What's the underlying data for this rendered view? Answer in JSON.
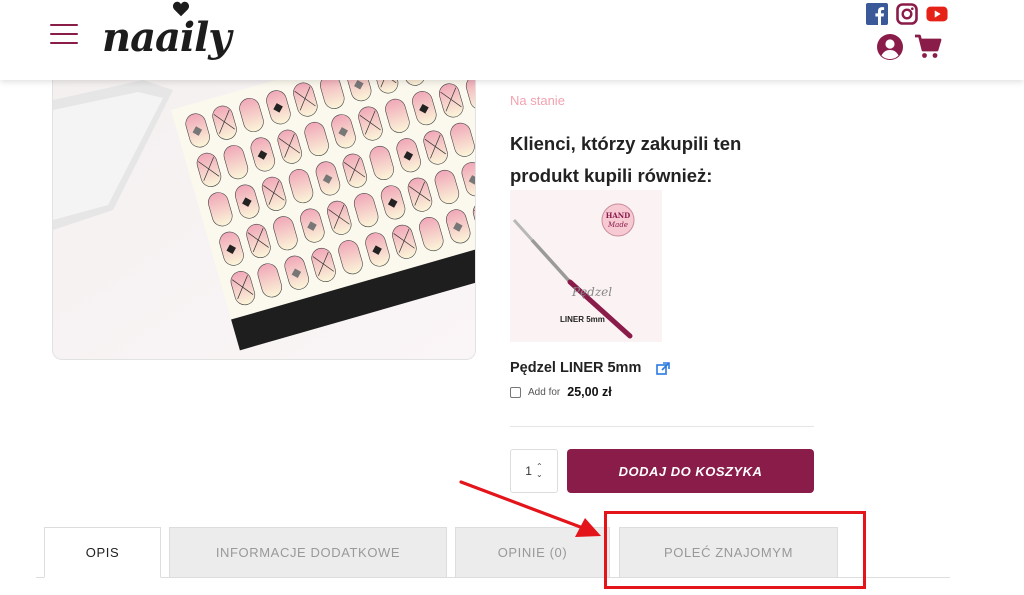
{
  "header": {
    "logo_text": "naaily",
    "menu_icon": "hamburger-menu-icon",
    "social_icons": [
      "facebook-icon",
      "instagram-icon",
      "youtube-icon"
    ],
    "account_icon": "user-account-icon",
    "cart_icon": "shopping-cart-icon",
    "brand_color": "#8a1c4a"
  },
  "product": {
    "stock_status": "Na stanie",
    "stock_color": "#f2a2b0"
  },
  "also_bought": {
    "title": "Klienci, którzy zakupili ten produkt kupili również:",
    "item": {
      "thumb_badge_line1": "HAND",
      "thumb_badge_line2": "Made",
      "thumb_script": "Pędzel",
      "thumb_caption": "LINER 5mm",
      "name": "Pędzel LINER 5mm",
      "add_for_label": "Add for",
      "price": "25,00 zł",
      "checked": false
    }
  },
  "cart": {
    "quantity": "1",
    "add_button_label": "DODAJ DO KOSZYKA"
  },
  "tabs": [
    {
      "label": "OPIS",
      "active": true
    },
    {
      "label": "INFORMACJE DODATKOWE",
      "active": false
    },
    {
      "label": "OPINIE (0)",
      "active": false
    },
    {
      "label": "POLEĆ ZNAJOMYM",
      "active": false
    }
  ],
  "annotation": {
    "color": "#e4141b",
    "target": "POLEĆ ZNAJOMYM"
  }
}
